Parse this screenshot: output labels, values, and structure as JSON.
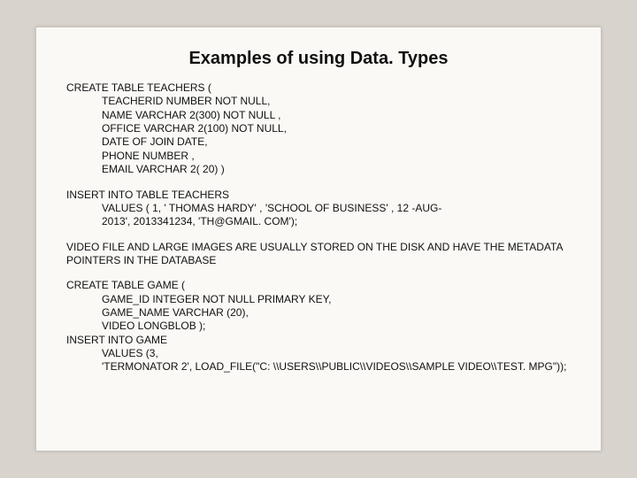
{
  "title": "Examples of using Data. Types",
  "block1": {
    "l0": "CREATE TABLE TEACHERS (",
    "l1": "TEACHERID NUMBER   NOT NULL,",
    "l2": "NAME    VARCHAR 2(300)  NOT NULL ,",
    "l3": "OFFICE   VARCHAR 2(100) NOT NULL,",
    "l4": "DATE OF JOIN DATE,",
    "l5": "PHONE  NUMBER ,",
    "l6": "EMAIL VARCHAR 2( 20) )"
  },
  "block2": {
    "l0": "INSERT INTO TABLE TEACHERS",
    "l1": "VALUES ( 1, ' THOMAS HARDY'  , 'SCHOOL OF BUSINESS'  , 12 -AUG-",
    "l2": "2013', 2013341234, 'TH@GMAIL. COM');"
  },
  "block3": {
    "l0": "VIDEO FILE AND LARGE IMAGES ARE USUALLY STORED ON THE DISK AND HAVE THE METADATA POINTERS IN THE DATABASE"
  },
  "block4": {
    "l0": "CREATE TABLE GAME  (",
    "l1": "GAME_ID INTEGER NOT NULL PRIMARY KEY,",
    "l2": "GAME_NAME VARCHAR (20),",
    "l3": "VIDEO  LONGBLOB );",
    "l4": "INSERT INTO GAME",
    "l5": "VALUES (3,",
    "l6": "'TERMONATOR 2', LOAD_FILE(\"C: \\\\USERS\\\\PUBLIC\\\\VIDEOS\\\\SAMPLE VIDEO\\\\TEST. MPG\"));"
  }
}
